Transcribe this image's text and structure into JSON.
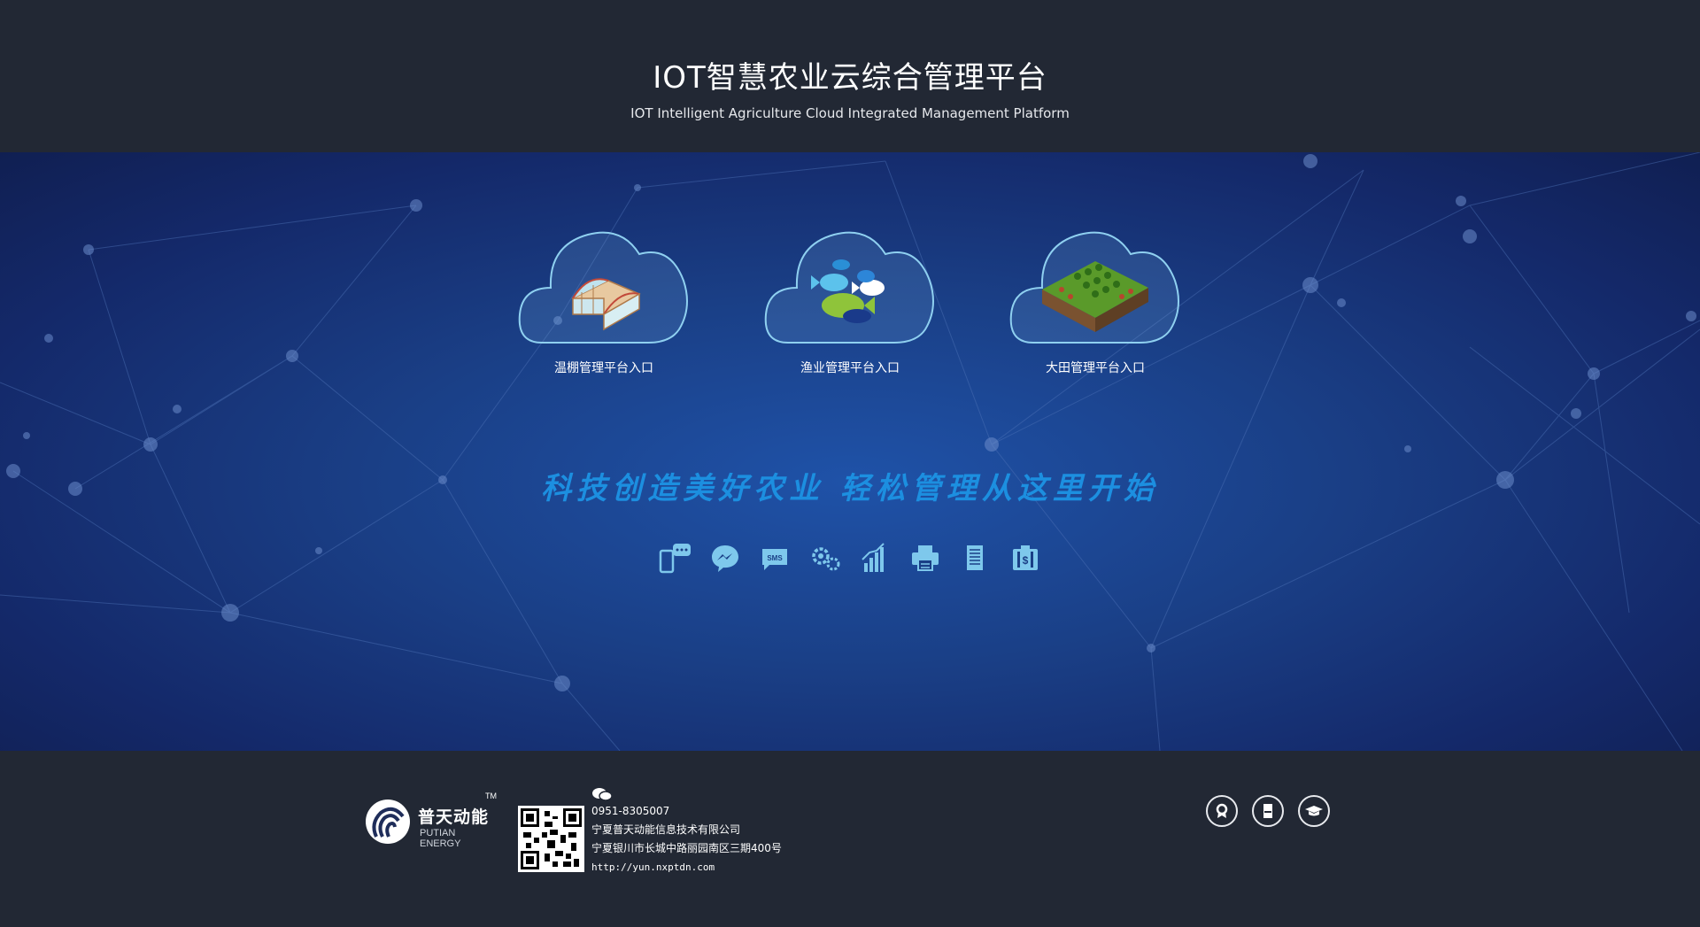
{
  "header": {
    "title": "IOT智慧农业云综合管理平台",
    "subtitle": "IOT Intelligent Agriculture Cloud Integrated Management Platform"
  },
  "portals": [
    {
      "label": "温棚管理平台入口",
      "icon": "greenhouse-icon"
    },
    {
      "label": "渔业管理平台入口",
      "icon": "fish-icon"
    },
    {
      "label": "大田管理平台入口",
      "icon": "field-icon"
    }
  ],
  "slogan": "科技创造美好农业  轻松管理从这里开始",
  "features": [
    "mobile-message-icon",
    "messenger-icon",
    "sms-icon",
    "gears-icon",
    "bar-chart-icon",
    "printer-icon",
    "document-icon",
    "money-clipboard-icon"
  ],
  "footer": {
    "logo_cn": "普天动能",
    "logo_en": "PUTIAN ENERGY",
    "logo_tm": "TM",
    "phone": "0951-8305007",
    "company": "宁夏普天动能信息技术有限公司",
    "address": "宁夏银川市长城中路丽园南区三期400号",
    "url": "http://yun.nxptdn.com",
    "circle_icons": [
      "award-icon",
      "door-icon",
      "graduation-cap-icon"
    ]
  },
  "colors": {
    "header_bg": "#222834",
    "banner_center": "#1f52a8",
    "banner_edge": "#101f52",
    "slogan": "#1c8fe0",
    "feature_icon": "#7ec8ec"
  }
}
